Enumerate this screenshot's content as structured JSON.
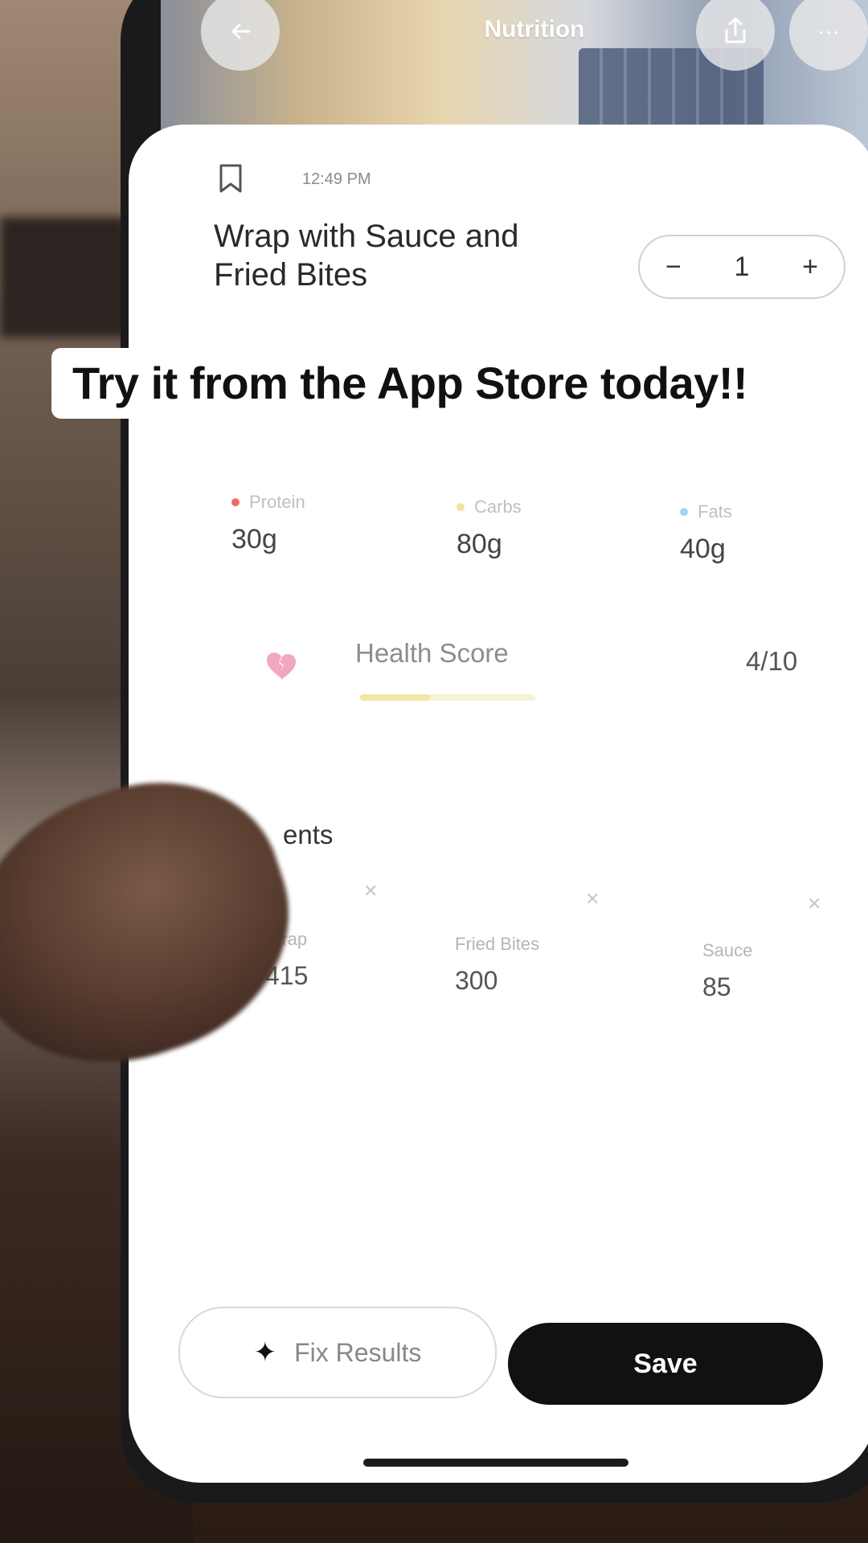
{
  "header": {
    "title": "Nutrition",
    "back_icon": "arrow-left-icon",
    "share_icon": "share-icon",
    "more_icon": "more-icon"
  },
  "entry": {
    "time": "12:49 PM",
    "food_name": "Wrap with Sauce and Fried Bites",
    "servings": "1",
    "decrement_label": "−",
    "increment_label": "+"
  },
  "overlay_caption": "Try it from the App Store today!!",
  "macros": [
    {
      "label": "Protein",
      "value": "30g",
      "color": "#f06a6a"
    },
    {
      "label": "Carbs",
      "value": "80g",
      "color": "#f3e3a0"
    },
    {
      "label": "Fats",
      "value": "40g",
      "color": "#9fd8ee"
    }
  ],
  "health": {
    "label": "Health Score",
    "value": "4/10",
    "score_fraction": 0.4,
    "icon": "broken-heart-icon",
    "color": "#f2a7c1"
  },
  "ingredients": {
    "heading_visible": "ents",
    "items": [
      {
        "name": "Wrap",
        "calories": "415"
      },
      {
        "name": "Fried Bites",
        "calories": "300"
      },
      {
        "name": "Sauce",
        "calories": "85"
      }
    ]
  },
  "actions": {
    "fix_label": "Fix Results",
    "save_label": "Save"
  }
}
